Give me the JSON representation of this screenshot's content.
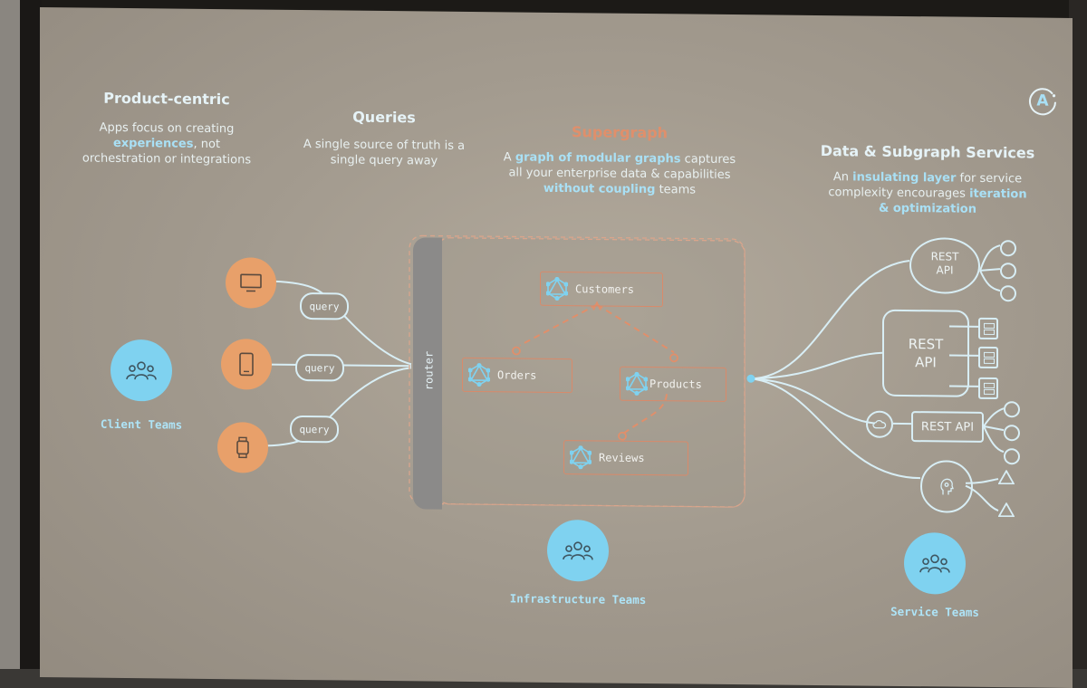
{
  "slide": {
    "logo": {
      "icon": "apollo-logo-icon",
      "letter": "A"
    },
    "columns": [
      {
        "title": "Product-centric",
        "desc_parts": [
          "Apps focus on creating ",
          "experiences",
          ", not orchestration or integrations"
        ]
      },
      {
        "title": "Queries",
        "desc_parts": [
          "A single source of truth is a single query away"
        ]
      },
      {
        "title": "Supergraph",
        "desc_parts": [
          "A ",
          "graph of modular graphs",
          " captures all your enterprise data & capabilities ",
          "without coupling",
          " teams"
        ]
      },
      {
        "title": "Data & Subgraph Services",
        "desc_parts": [
          "An ",
          "insulating layer",
          " for service complexity encourages ",
          "iteration & optimization"
        ]
      }
    ],
    "devices": [
      {
        "icon": "monitor-icon"
      },
      {
        "icon": "phone-icon"
      },
      {
        "icon": "watch-icon"
      }
    ],
    "query_label": "query",
    "router_label": "router",
    "subgraphs": [
      {
        "name": "Customers",
        "icon": "graphql-icon"
      },
      {
        "name": "Orders",
        "icon": "graphql-icon"
      },
      {
        "name": "Products",
        "icon": "graphql-icon"
      },
      {
        "name": "Reviews",
        "icon": "graphql-icon"
      }
    ],
    "services": [
      {
        "label_lines": [
          "REST",
          "API"
        ],
        "shape": "circle",
        "children": "circles"
      },
      {
        "label_lines": [
          "REST",
          "API"
        ],
        "shape": "rounded-box",
        "children": "database-icons"
      },
      {
        "label_lines": [
          "REST API"
        ],
        "shape": "box",
        "prefix_icon": "cloud-icon",
        "children": "circles"
      },
      {
        "label_lines": [],
        "shape": "circle",
        "icon": "head-ai-icon",
        "children": "triangles"
      }
    ],
    "teams": {
      "client": "Client Teams",
      "infrastructure": "Infrastructure Teams",
      "service": "Service Teams"
    },
    "colors": {
      "accent_blue": "#7fd2f0",
      "accent_orange": "#e8a06a",
      "subgraph_border": "#d98a6a",
      "title_orange": "#e08f6b",
      "line_color": "#d8eef5"
    }
  }
}
